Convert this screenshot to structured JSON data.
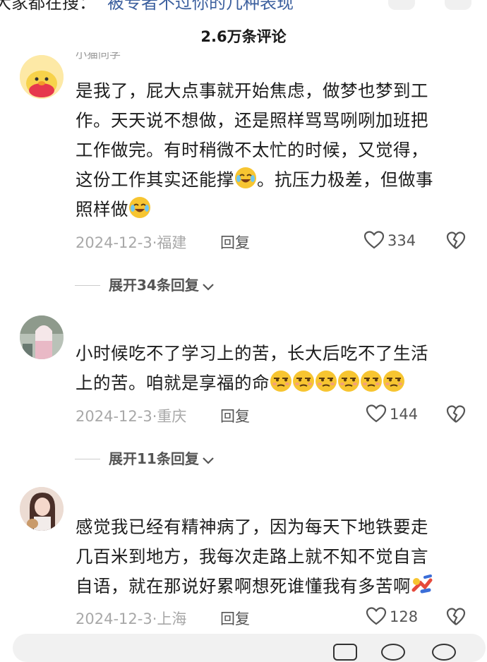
{
  "top_strip": {
    "left_text": "大家都在搜：",
    "link_text": "被专者不过你的几种表现"
  },
  "header": {
    "title": "2.6万条评论"
  },
  "comments": [
    {
      "username": "小猫同学",
      "lines": [
        "是我了，屁大点事就开始焦虑，做梦也梦到工",
        "作。天天说不想做，还是照样骂骂咧咧加班把",
        "工作做完。有时稍微不太忙的时候，又觉得，",
        "这份工作其实还能撑",
        "。抗压力极差，但做事",
        "照样做"
      ],
      "date": "2024-12-3",
      "location": "福建",
      "reply_label": "回复",
      "likes": "334",
      "expand_label": "展开34条回复"
    },
    {
      "username": "",
      "lines": [
        "小时候吃不了学习上的苦，长大后吃不了生活",
        "上的苦。咱就是享福的命"
      ],
      "date": "2024-12-3",
      "location": "重庆",
      "reply_label": "回复",
      "likes": "144",
      "expand_label": "展开11条回复"
    },
    {
      "username": "",
      "lines": [
        "感觉我已经有精神病了，因为每天下地铁要走",
        "几百米到地方，我每次走路上就不知不觉自言",
        "自语，就在那说好累啊想死谁懂我有多苦啊"
      ],
      "date": "2024-12-3",
      "location": "上海",
      "reply_label": "回复",
      "likes": "128"
    }
  ],
  "colors": {
    "link": "#3b5f9e",
    "meta": "#a8a8a8",
    "emoji_yellow": "#f7c531"
  }
}
